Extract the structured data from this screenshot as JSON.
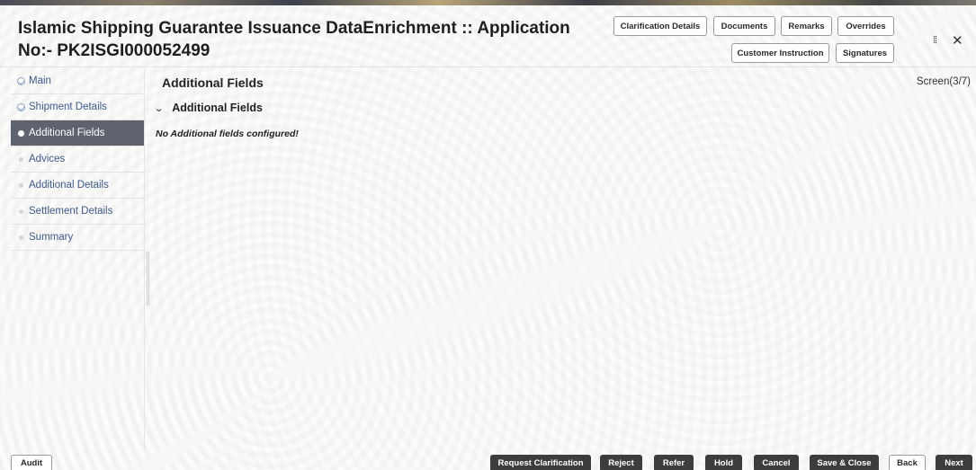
{
  "header": {
    "title": "Islamic Shipping Guarantee Issuance DataEnrichment :: Application No:- PK2ISGI000052499",
    "buttons": {
      "clarification_details": "Clarification Details",
      "documents": "Documents",
      "remarks": "Remarks",
      "overrides": "Overrides",
      "customer_instruction": "Customer Instruction",
      "signatures": "Signatures"
    },
    "window_controls": {
      "collapse_icon": "⁞⁞",
      "close_icon": "✕"
    }
  },
  "sidebar": {
    "items": [
      {
        "label": "Main",
        "state": "done"
      },
      {
        "label": "Shipment Details",
        "state": "done"
      },
      {
        "label": "Additional Fields",
        "state": "current"
      },
      {
        "label": "Advices",
        "state": "pending"
      },
      {
        "label": "Additional Details",
        "state": "pending"
      },
      {
        "label": "Settlement Details",
        "state": "pending"
      },
      {
        "label": "Summary",
        "state": "pending"
      }
    ]
  },
  "main": {
    "section_title": "Additional Fields",
    "screen_counter": "Screen(3/7)",
    "panel": {
      "label": "Additional Fields",
      "expanded": true,
      "empty_message": "No Additional fields configured!"
    }
  },
  "footer": {
    "audit": "Audit",
    "request_clarification": "Request Clarification",
    "reject": "Reject",
    "refer": "Refer",
    "hold": "Hold",
    "cancel": "Cancel",
    "save_close": "Save & Close",
    "back": "Back",
    "next": "Next"
  },
  "colors": {
    "active_nav_bg": "#5f6370",
    "nav_link": "#3b5a8c",
    "dark_button": "#3d3d3d"
  }
}
